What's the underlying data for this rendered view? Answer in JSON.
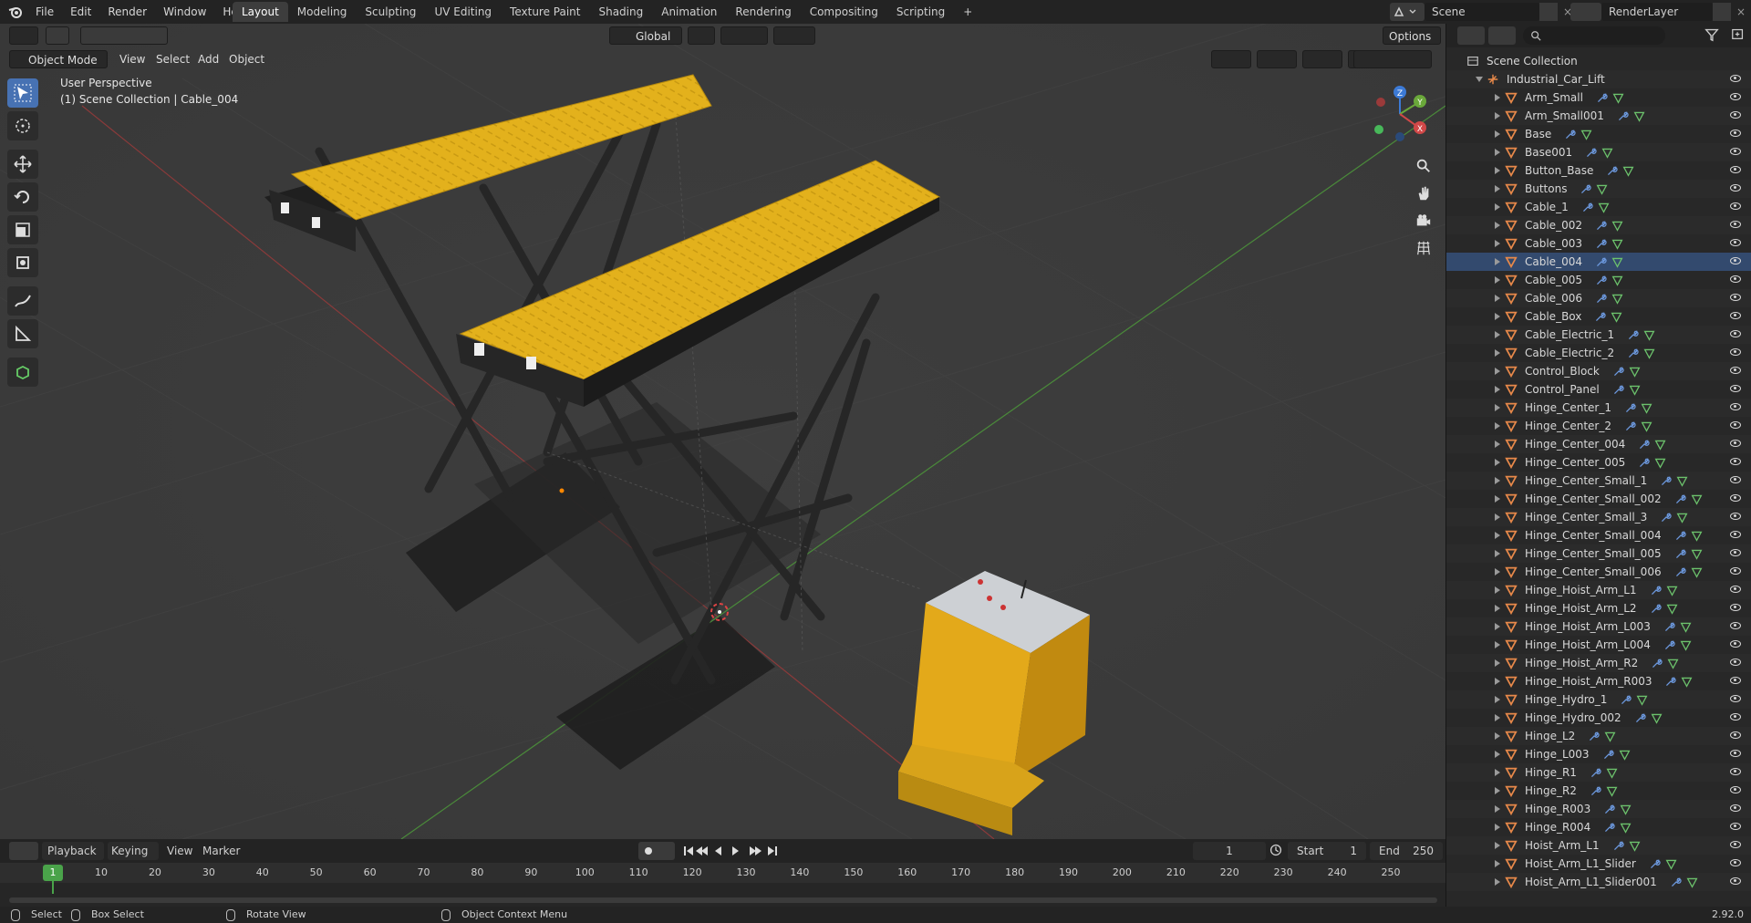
{
  "menu": {
    "file": "File",
    "edit": "Edit",
    "render": "Render",
    "window": "Window",
    "help": "Help"
  },
  "workspaces": [
    "Layout",
    "Modeling",
    "Sculpting",
    "UV Editing",
    "Texture Paint",
    "Shading",
    "Animation",
    "Rendering",
    "Compositing",
    "Scripting"
  ],
  "workspace_add": "+",
  "scene": {
    "label": "Scene",
    "value": "Scene"
  },
  "view_layer": {
    "value": "RenderLayer"
  },
  "viewport_header": {
    "transform_orientation": "Global",
    "options": "Options",
    "mode": "Object Mode",
    "view": "View",
    "select": "Select",
    "add": "Add",
    "object": "Object"
  },
  "viewport_overlay": {
    "perspective": "User Perspective",
    "context": "(1) Scene Collection | Cable_004"
  },
  "gizmo": {
    "z": "Z",
    "y": "Y",
    "x": "X"
  },
  "outliner": {
    "root": "Scene Collection",
    "collection": "Industrial_Car_Lift",
    "items": [
      "Arm_Small",
      "Arm_Small001",
      "Base",
      "Base001",
      "Button_Base",
      "Buttons",
      "Cable_1",
      "Cable_002",
      "Cable_003",
      "Cable_004",
      "Cable_005",
      "Cable_006",
      "Cable_Box",
      "Cable_Electric_1",
      "Cable_Electric_2",
      "Control_Block",
      "Control_Panel",
      "Hinge_Center_1",
      "Hinge_Center_2",
      "Hinge_Center_004",
      "Hinge_Center_005",
      "Hinge_Center_Small_1",
      "Hinge_Center_Small_002",
      "Hinge_Center_Small_3",
      "Hinge_Center_Small_004",
      "Hinge_Center_Small_005",
      "Hinge_Center_Small_006",
      "Hinge_Hoist_Arm_L1",
      "Hinge_Hoist_Arm_L2",
      "Hinge_Hoist_Arm_L003",
      "Hinge_Hoist_Arm_L004",
      "Hinge_Hoist_Arm_R2",
      "Hinge_Hoist_Arm_R003",
      "Hinge_Hydro_1",
      "Hinge_Hydro_002",
      "Hinge_L2",
      "Hinge_L003",
      "Hinge_R1",
      "Hinge_R2",
      "Hinge_R003",
      "Hinge_R004",
      "Hoist_Arm_L1",
      "Hoist_Arm_L1_Slider",
      "Hoist_Arm_L1_Slider001"
    ],
    "selected_item": "Cable_004"
  },
  "timeline": {
    "playback": "Playback",
    "keying": "Keying",
    "view": "View",
    "marker": "Marker",
    "current_frame": "1",
    "start_label": "Start",
    "start": "1",
    "end_label": "End",
    "end": "250",
    "ruler": [
      "1",
      "10",
      "20",
      "30",
      "40",
      "50",
      "60",
      "70",
      "80",
      "90",
      "100",
      "110",
      "120",
      "130",
      "140",
      "150",
      "160",
      "170",
      "180",
      "190",
      "200",
      "210",
      "220",
      "230",
      "240",
      "250"
    ]
  },
  "statusbar": {
    "select": "Select",
    "box_select": "Box Select",
    "rotate_view": "Rotate View",
    "context_menu": "Object Context Menu",
    "version": "2.92.0"
  },
  "colors": {
    "accent": "#4772b3",
    "active_frame": "#4aa34a",
    "lift_yellow": "#e6b31d",
    "mesh_orange": "#e8894a"
  }
}
